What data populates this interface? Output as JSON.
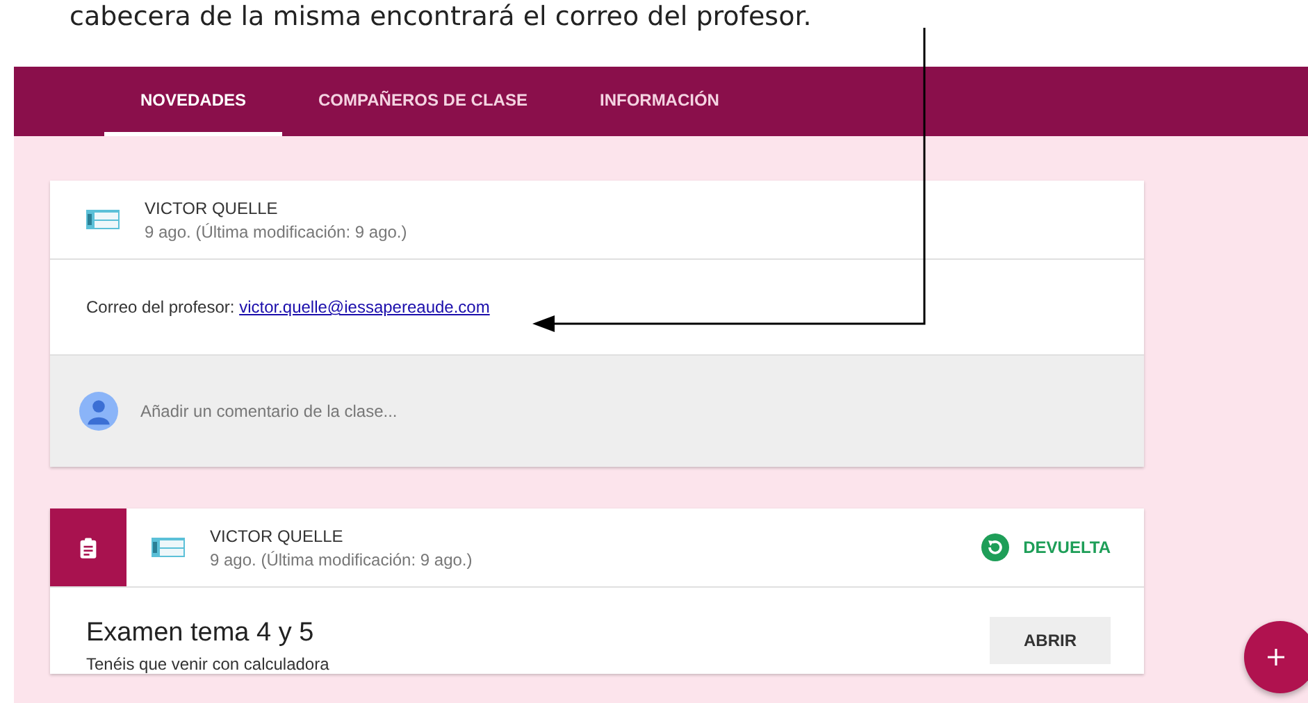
{
  "caption": "cabecera de la misma encontrará el correo del profesor.",
  "tabs": [
    {
      "label": "NOVEDADES",
      "selected": true
    },
    {
      "label": "COMPAÑEROS DE CLASE",
      "selected": false
    },
    {
      "label": "INFORMACIÓN",
      "selected": false
    }
  ],
  "announcement": {
    "author": "VICTOR QUELLE",
    "date": "9 ago. (Última modificación: 9 ago.)",
    "text": "Correo del profesor: ",
    "link": "victor.quelle@iessapereaude.com",
    "comment_placeholder": "Añadir un comentario de la clase..."
  },
  "assignment": {
    "author": "VICTOR QUELLE",
    "date": "9 ago. (Última modificación: 9 ago.)",
    "status": "DEVUELTA",
    "title": "Examen tema 4 y 5",
    "description": "Tenéis que venir con calculadora",
    "button": "ABRIR"
  }
}
